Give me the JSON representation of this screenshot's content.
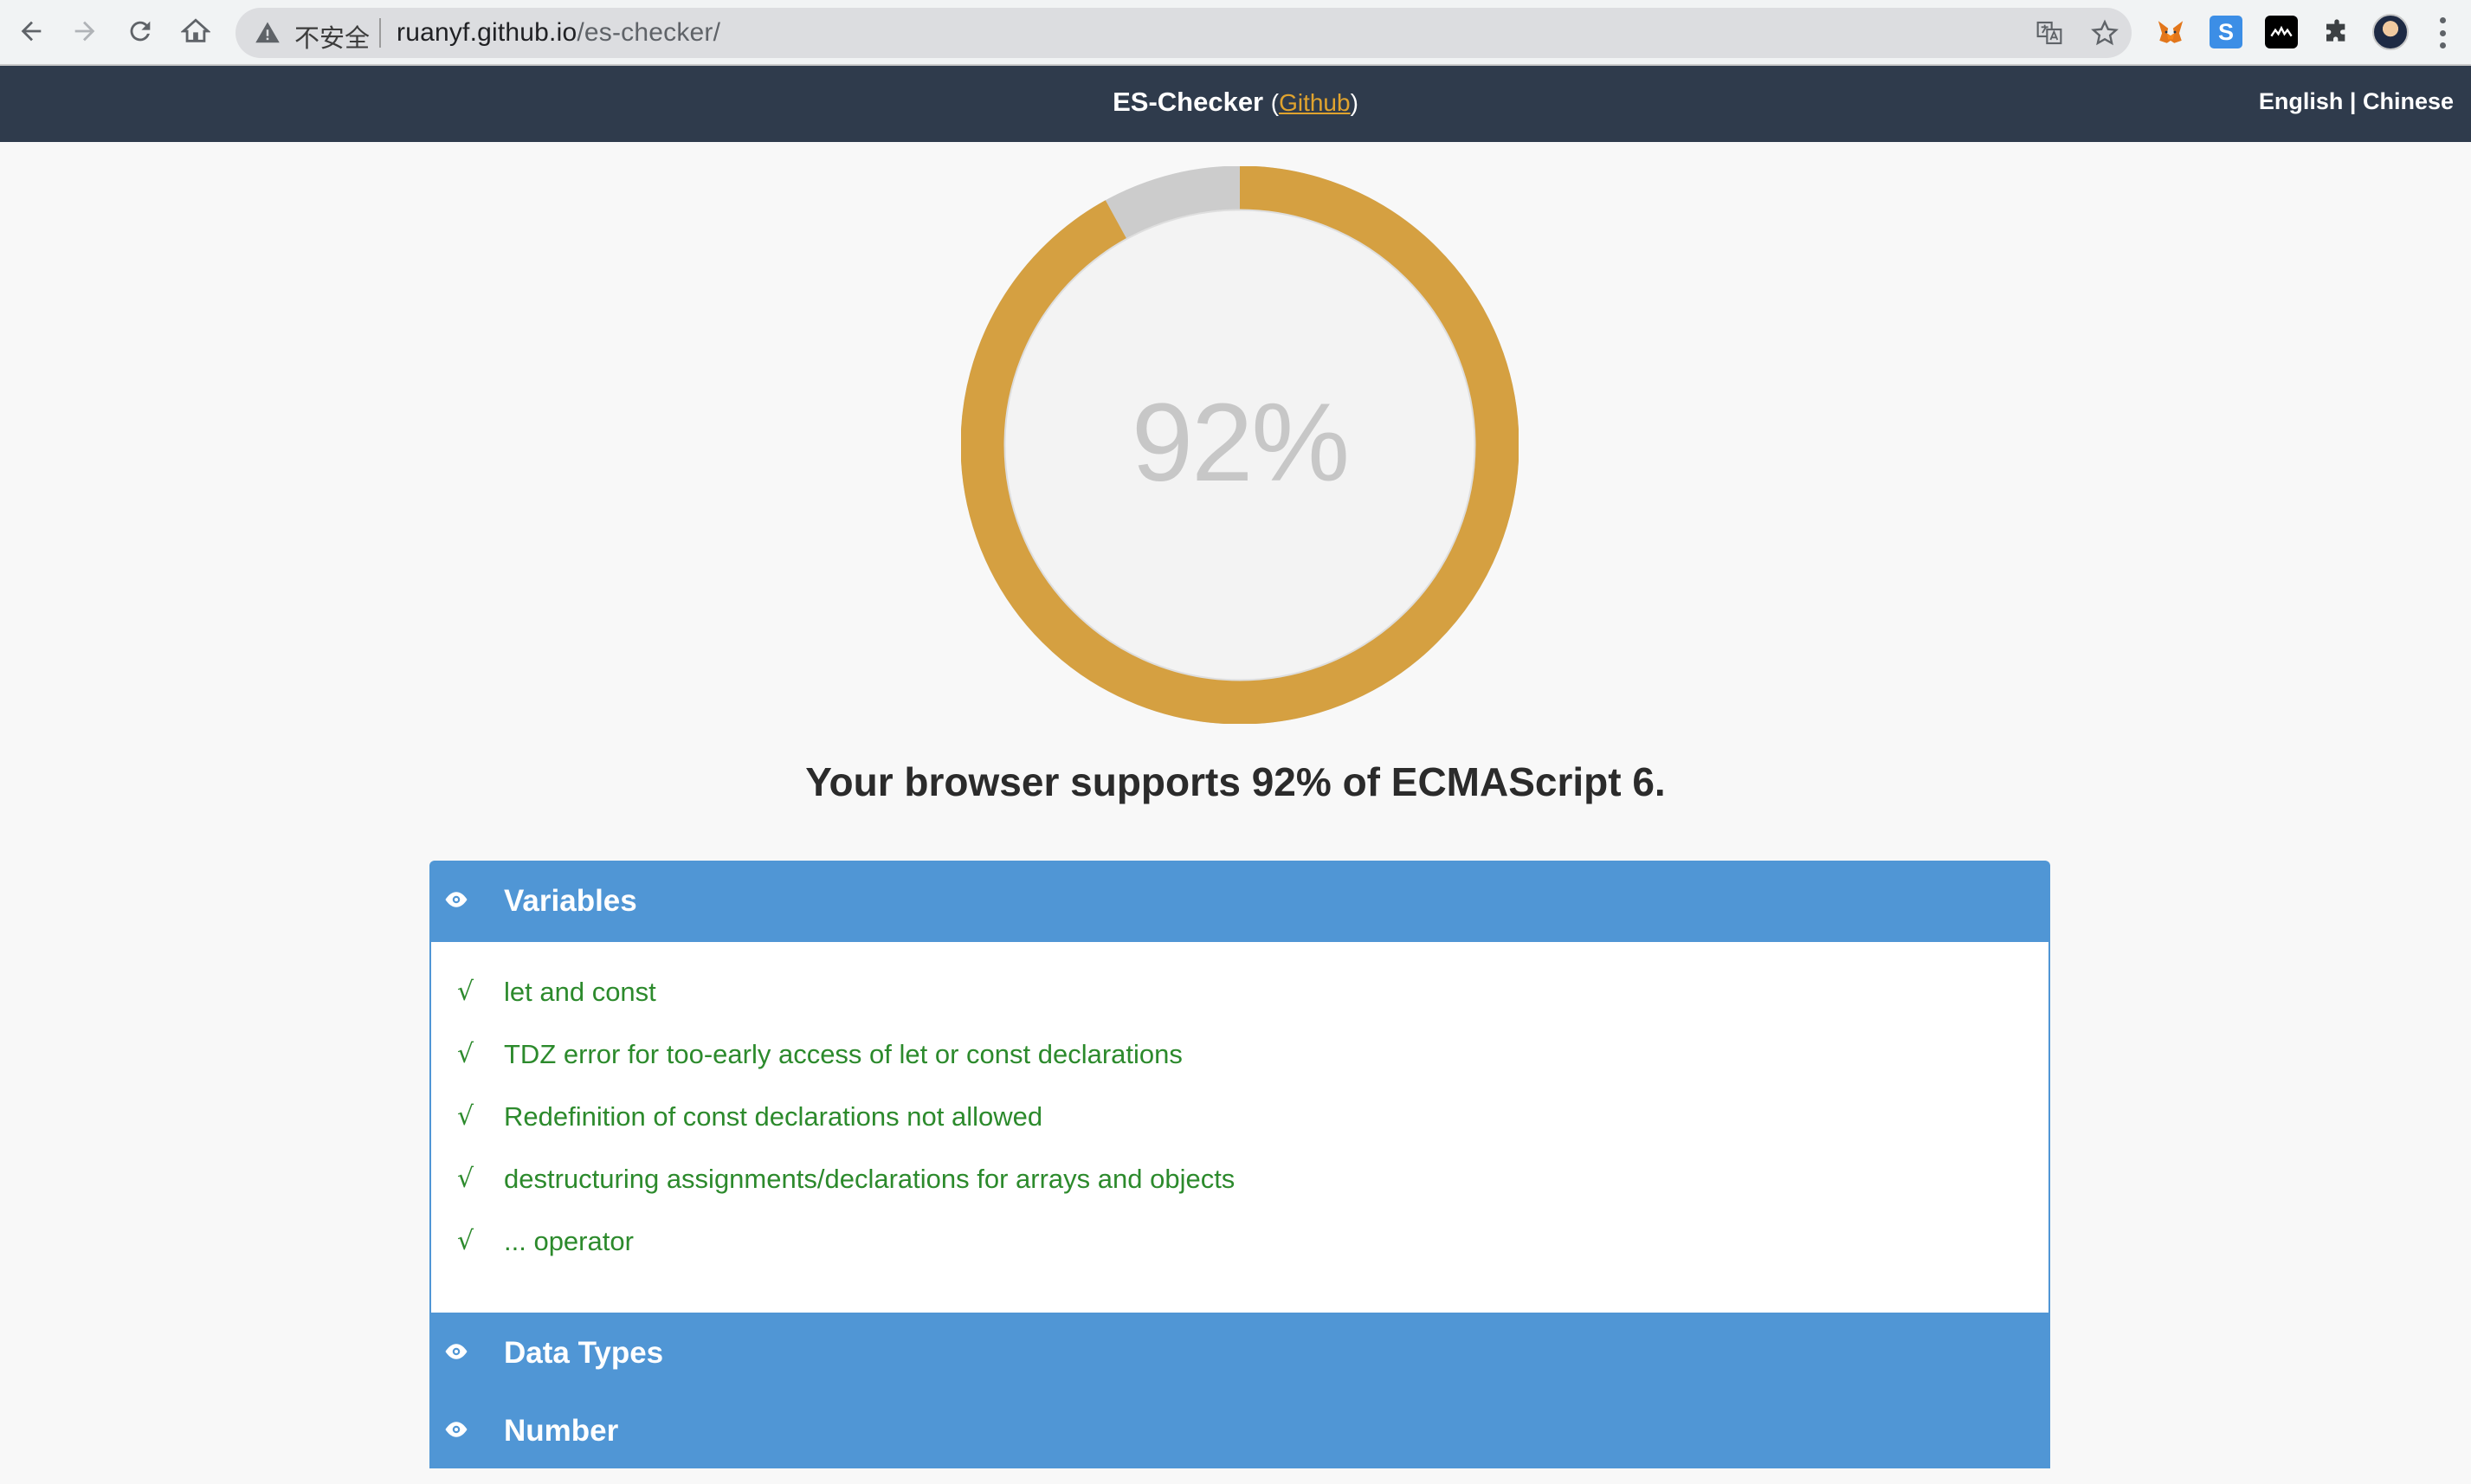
{
  "browser": {
    "security_label": "不安全",
    "url_host": "ruanyf.github.io",
    "url_path": "/es-checker/"
  },
  "header": {
    "title": "ES-Checker",
    "paren_open": "(",
    "github_link": "Github",
    "paren_close": ")",
    "lang_english": "English",
    "lang_sep": " | ",
    "lang_chinese": "Chinese"
  },
  "score": {
    "percent_text": "92%",
    "value": 0.92,
    "color_filled": "#d5a041",
    "color_empty": "#cccccc"
  },
  "headline": "Your browser supports 92% of ECMAScript 6.",
  "sections": [
    {
      "label": "Variables",
      "items": [
        "let and const",
        "TDZ error for too-early access of let or const declarations",
        "Redefinition of const declarations not allowed",
        "destructuring assignments/declarations for arrays and objects",
        "... operator"
      ],
      "check_mark": "√"
    },
    {
      "label": "Data Types"
    },
    {
      "label": "Number"
    }
  ],
  "colors": {
    "topbar": "#2f3b4c",
    "section_header": "#5096d5",
    "pass_text": "#2c8a2c"
  }
}
